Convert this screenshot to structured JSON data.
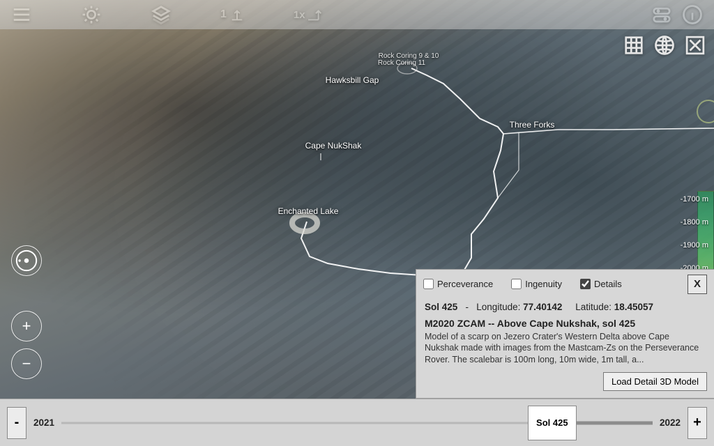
{
  "toolbar": {
    "vert_exag": "1",
    "hor_scale": "1x"
  },
  "corner_tools": {
    "grid": "grid",
    "globe": "globe",
    "close": "X"
  },
  "waypoints": {
    "rock_coring_a": "Rock Coring 9 & 10",
    "rock_coring_b": "Rock Coring 11",
    "hawksbill": "Hawksbill Gap",
    "three_forks": "Three Forks",
    "cape": "Cape NukShak",
    "enchanted": "Enchanted Lake"
  },
  "elevation_labels": [
    "-1700 m",
    "-1800 m",
    "-1900 m",
    "-2000 m"
  ],
  "panel": {
    "checks": {
      "perseverance": "Perceverance",
      "ingenuity": "Ingenuity",
      "details": "Details"
    },
    "close": "X",
    "sol_label": "Sol 425",
    "lon_label": "Longitude:",
    "lon_value": "77.40142",
    "lat_label": "Latitude:",
    "lat_value": "18.45057",
    "title": "M2020 ZCAM -- Above Cape Nukshak, sol 425",
    "desc": "Model of a scarp on Jezero Crater's Western Delta above Cape Nukshak made with images from the Mastcam-Zs on the Perseverance Rover. The scalebar is 100m long, 10m wide, 1m tall, a...",
    "load_btn": "Load Detail 3D Model"
  },
  "timeline": {
    "minus": "-",
    "plus": "+",
    "year_start": "2021",
    "year_end": "2022",
    "marker": "Sol 425",
    "marker_pct": 83,
    "dark_from_pct": 84,
    "dark_to_pct": 100
  }
}
